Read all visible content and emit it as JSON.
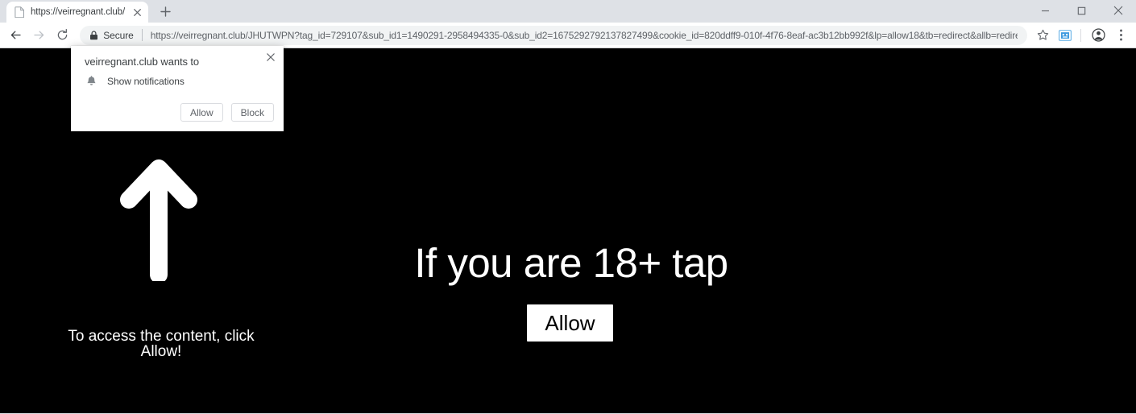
{
  "window": {
    "controls": [
      {
        "name": "minimize",
        "glyph": "–"
      },
      {
        "name": "maximize",
        "glyph": "□"
      },
      {
        "name": "close",
        "glyph": "✕"
      }
    ]
  },
  "tabstrip": {
    "tabs": [
      {
        "title": "https://veirregnant.club/JHUTWP",
        "favicon": "page-icon",
        "close_glyph": "✕",
        "active": true
      }
    ],
    "new_tab_glyph": "+",
    "new_tab_label": "New tab"
  },
  "toolbar": {
    "back_label": "Back",
    "forward_label": "Forward",
    "reload_label": "Reload",
    "security_label": "Secure",
    "url": "https://veirregnant.club/JHUTWPN?tag_id=729107&sub_id1=1490291-2958494335-0&sub_id2=1675292792137827499&cookie_id=820ddff9-010f-4f76-8eaf-ac3b12bb992f&lp=allow18&tb=redirect&allb=redirect&o…",
    "bookmark_label": "Bookmark this page",
    "extension_label": "Extension",
    "profile_label": "Profile",
    "menu_label": "Customize and control Google Chrome"
  },
  "permission_bubble": {
    "title": "veirregnant.club wants to",
    "permission": "Show notifications",
    "close_glyph": "✕",
    "allow_label": "Allow",
    "block_label": "Block"
  },
  "page_content": {
    "background_color": "#000000",
    "text_color": "#ffffff",
    "arrow_label": "up-arrow",
    "hint_line1": "To access the content, click",
    "hint_line2": "Allow!",
    "headline": "If you are 18+ tap",
    "cta_label": "Allow"
  }
}
